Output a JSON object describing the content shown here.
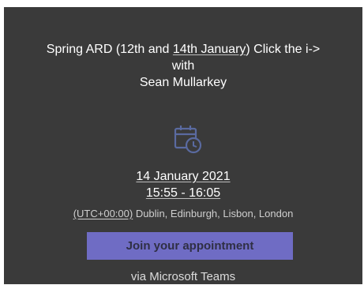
{
  "meeting": {
    "title_part1": "Spring ARD (12th and ",
    "title_link": "14th January",
    "title_part2": ") Click the i->",
    "with_label": "with",
    "organizer": "Sean Mullarkey"
  },
  "schedule": {
    "date": "14 January 2021",
    "time": "15:55 - 16:05",
    "timezone_offset": "(UTC+00:00)",
    "timezone_name": " Dublin, Edinburgh, Lisbon, London"
  },
  "actions": {
    "join_label": "Join your appointment",
    "via_label": "via Microsoft Teams"
  },
  "icons": {
    "calendar": "calendar-clock-icon"
  },
  "colors": {
    "background": "#3a3a3a",
    "button": "#6f6cc4",
    "icon": "#5a6aa0"
  }
}
